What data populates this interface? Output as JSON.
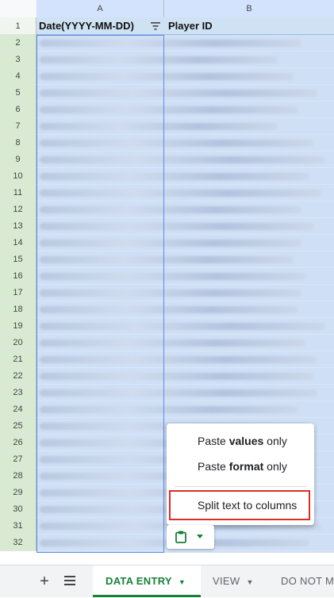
{
  "columns": {
    "a": "A",
    "b": "B"
  },
  "header_row": {
    "number": "1",
    "date_header": "Date(YYYY-MM-DD)",
    "player_header": "Player ID"
  },
  "rows": [
    "2",
    "3",
    "4",
    "5",
    "6",
    "7",
    "8",
    "9",
    "10",
    "11",
    "12",
    "13",
    "14",
    "15",
    "16",
    "17",
    "18",
    "19",
    "20",
    "21",
    "22",
    "23",
    "24",
    "25",
    "26",
    "27",
    "28",
    "29",
    "30",
    "31",
    "32"
  ],
  "menu": {
    "paste_values_prefix": "Paste ",
    "paste_values_bold": "values",
    "paste_values_suffix": " only",
    "paste_format_prefix": "Paste ",
    "paste_format_bold": "format",
    "paste_format_suffix": " only",
    "split_text": "Split text to columns"
  },
  "tabs": {
    "add": "+",
    "active": "DATA ENTRY",
    "second": "VIEW",
    "third": "DO NOT M"
  },
  "colors": {
    "accent_green": "#188038",
    "selection_blue": "#cfdff5",
    "highlight_red": "#d93025"
  },
  "icons": [
    "filter-icon",
    "paste-clipboard-icon",
    "chevron-down-icon",
    "add-sheet-icon",
    "all-sheets-icon"
  ]
}
